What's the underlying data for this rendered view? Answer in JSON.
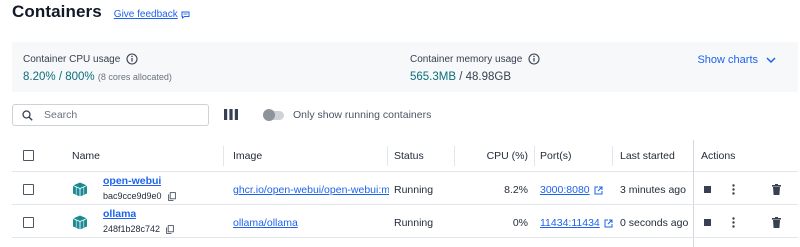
{
  "header": {
    "title": "Containers",
    "feedback_label": "Give feedback"
  },
  "stats": {
    "cpu": {
      "label": "Container CPU usage",
      "used": "8.20%",
      "separator": "/",
      "total": "800%",
      "note": "(8 cores allocated)"
    },
    "memory": {
      "label": "Container memory usage",
      "used": "565.3MB",
      "separator": "/",
      "total": "48.98GB"
    },
    "show_charts_label": "Show charts"
  },
  "toolbar": {
    "search_placeholder": "Search",
    "toggle_label": "Only show running containers",
    "only_running": false
  },
  "table": {
    "columns": {
      "name": "Name",
      "image": "Image",
      "status": "Status",
      "cpu": "CPU (%)",
      "ports": "Port(s)",
      "last_started": "Last started",
      "actions": "Actions"
    },
    "rows": [
      {
        "name": "open-webui",
        "id": "bac9cce9d9e0",
        "image": "ghcr.io/open-webui/open-webui:main",
        "status": "Running",
        "cpu": "8.2%",
        "ports": "3000:8080",
        "last_started": "3 minutes ago"
      },
      {
        "name": "ollama",
        "id": "248f1b28c742",
        "image": "ollama/ollama",
        "status": "Running",
        "cpu": "0%",
        "ports": "11434:11434",
        "last_started": "0 seconds ago"
      }
    ]
  },
  "colors": {
    "accent": "#1d63ed",
    "stat_value": "#0b6e7a",
    "container_icon": "#1a8a94"
  }
}
